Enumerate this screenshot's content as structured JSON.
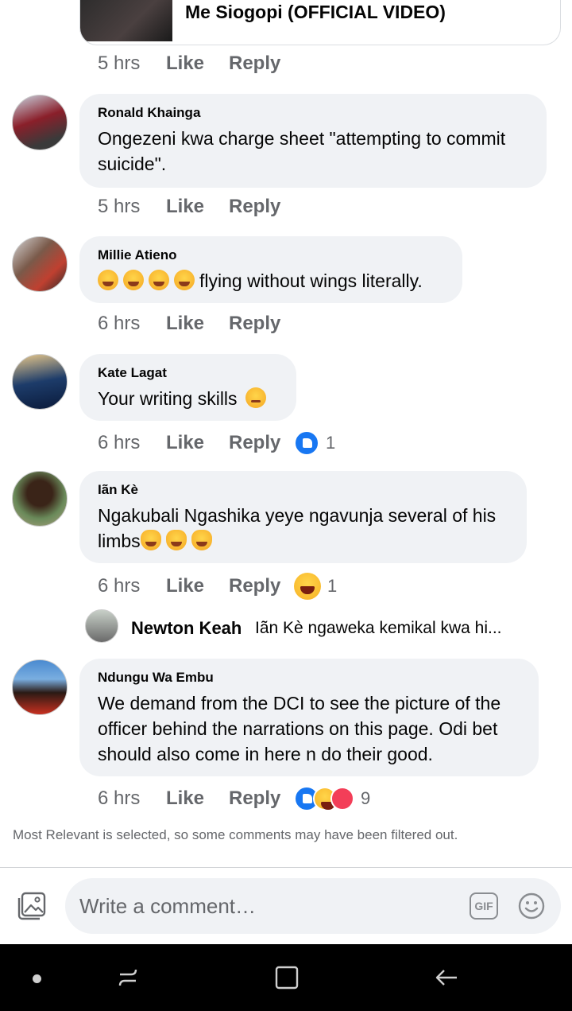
{
  "link_card": {
    "title": "Me Siogopi (OFFICIAL VIDEO)"
  },
  "post_actions": {
    "time": "5 hrs",
    "like": "Like",
    "reply": "Reply"
  },
  "comments": [
    {
      "author": "Ronald Khainga",
      "text": "Ongezeni kwa charge sheet \"attempting to commit suicide\".",
      "time": "5 hrs",
      "like": "Like",
      "reply": "Reply"
    },
    {
      "author": "Millie Atieno",
      "text": "flying without wings literally.",
      "emoji_prefix": [
        "rolling-laughing-emoji",
        "rolling-laughing-emoji",
        "rolling-laughing-emoji",
        "rolling-laughing-emoji"
      ],
      "time": "6 hrs",
      "like": "Like",
      "reply": "Reply"
    },
    {
      "author": "Kate Lagat",
      "text": "Your writing skills",
      "emoji_suffix": "winking-emoji",
      "time": "6 hrs",
      "like": "Like",
      "reply": "Reply",
      "reaction_count": "1",
      "reactions": [
        "like"
      ]
    },
    {
      "author": "Iãn Kè",
      "text_line1": "Ngakubali Ngashika yeye ngavunja several of his",
      "text_line2": "limbs",
      "emoji_suffix": [
        "crying-laughing-cat-emoji",
        "crying-laughing-cat-emoji",
        "crying-laughing-cat-emoji"
      ],
      "time": "6 hrs",
      "like": "Like",
      "reply": "Reply",
      "reaction_count": "1",
      "reactions": [
        "haha"
      ]
    },
    {
      "author": "Ndungu Wa Embu",
      "text": "We demand from the DCI to see the picture of the officer behind the narrations on this page. Odi bet should also come in here n do their good.",
      "time": "6 hrs",
      "like": "Like",
      "reply": "Reply",
      "reaction_count": "9",
      "reactions": [
        "like",
        "haha",
        "love"
      ]
    }
  ],
  "reply_preview": {
    "author": "Newton Keah",
    "text": "Iãn Kè ngaweka kemikal kwa hi..."
  },
  "filter_note": "Most Relevant is selected, so some comments may have been filtered out.",
  "composer": {
    "placeholder": "Write a comment…",
    "gif_label": "GIF"
  },
  "colors": {
    "bubble": "#f0f2f5",
    "like_blue": "#1877f2",
    "muted": "#65676b",
    "love_red": "#f33e58"
  }
}
